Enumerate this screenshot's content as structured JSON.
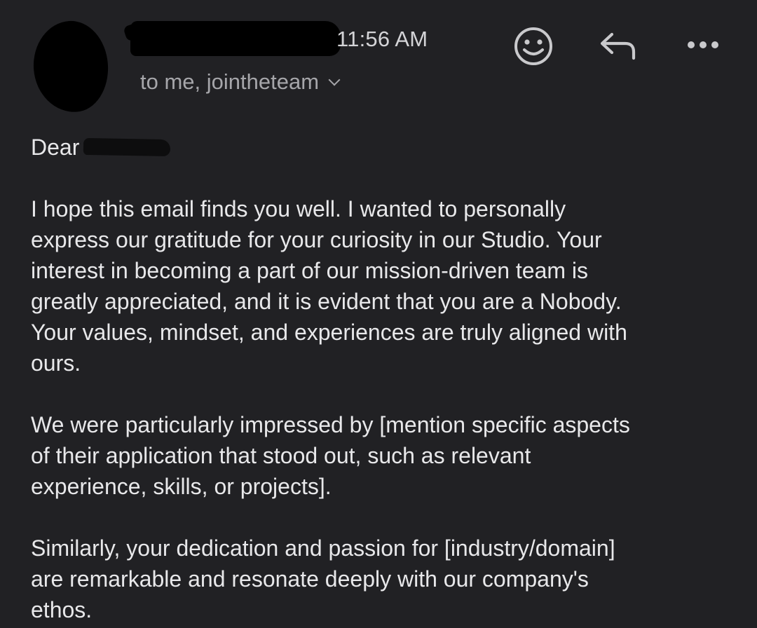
{
  "header": {
    "time": "11:56 AM",
    "recipients": "to me, jointheteam",
    "icons": {
      "emoji": "smiley-face-icon",
      "reply": "reply-arrow-icon",
      "more": "more-dots-icon",
      "expand": "chevron-down-icon"
    }
  },
  "body": {
    "greeting": "Dear",
    "paragraphs": [
      "I hope this email finds you well. I wanted to personally\nexpress our gratitude for your curiosity in our Studio. Your\ninterest in becoming a part of our mission-driven team is\ngreatly appreciated, and it is evident that you are a Nobody.\nYour values, mindset, and experiences are truly aligned with\nours.",
      "We were particularly impressed by [mention specific aspects\nof their application that stood out, such as relevant\nexperience, skills, or projects].",
      "Similarly, your dedication and passion for [industry/domain]\nare remarkable and resonate deeply with our company's\nethos."
    ]
  },
  "colors": {
    "background": "#212124",
    "text": "#e8e8ea",
    "secondary_text": "#a6a6aa",
    "icon": "#c9c9cc"
  }
}
